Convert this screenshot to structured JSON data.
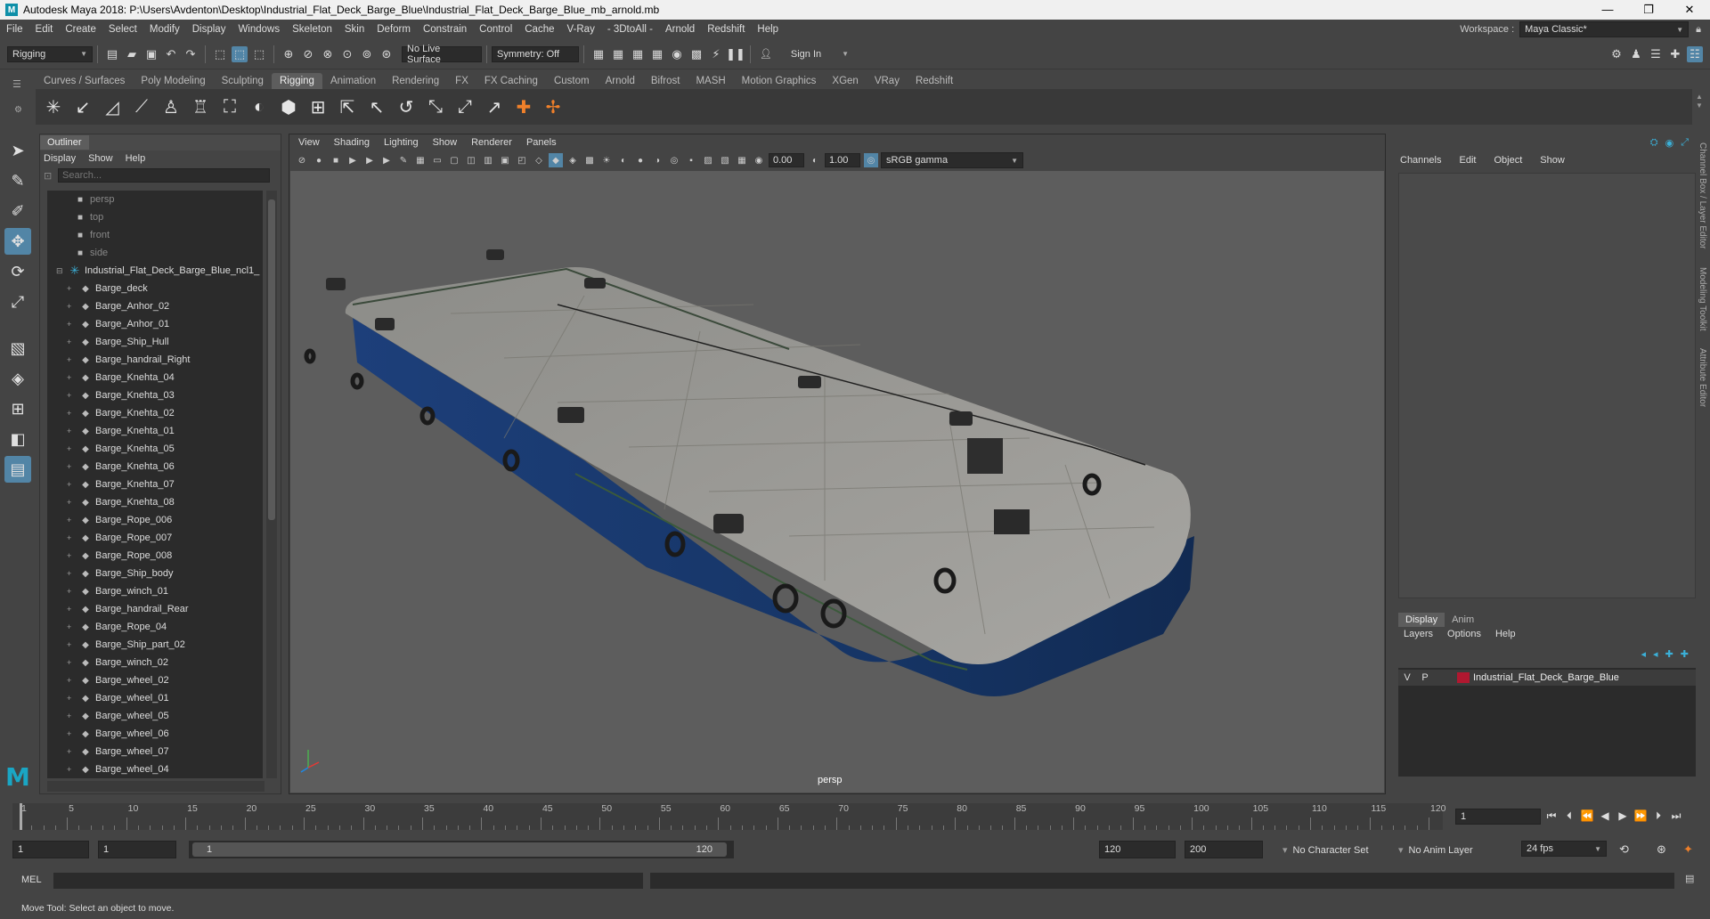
{
  "window": {
    "title": "Autodesk Maya 2018: P:\\Users\\Avdenton\\Desktop\\Industrial_Flat_Deck_Barge_Blue\\Industrial_Flat_Deck_Barge_Blue_mb_arnold.mb",
    "min": "—",
    "max": "❐",
    "close": "✕"
  },
  "menubar": {
    "items": [
      "File",
      "Edit",
      "Create",
      "Select",
      "Modify",
      "Display",
      "Windows",
      "Skeleton",
      "Skin",
      "Deform",
      "Constrain",
      "Control",
      "Cache",
      "V-Ray",
      "- 3DtoAll -",
      "Arnold",
      "Redshift",
      "Help"
    ],
    "workspace_label": "Workspace :",
    "workspace_value": "Maya Classic*"
  },
  "statusline": {
    "menuset": "Rigging",
    "live_surface": "No Live Surface",
    "symmetry": "Symmetry: Off",
    "sign_in": "Sign In"
  },
  "shelf": {
    "tabs": [
      "Curves / Surfaces",
      "Poly Modeling",
      "Sculpting",
      "Rigging",
      "Animation",
      "Rendering",
      "FX",
      "FX Caching",
      "Custom",
      "Arnold",
      "Bifrost",
      "MASH",
      "Motion Graphics",
      "XGen",
      "VRay",
      "Redshift"
    ],
    "active_tab": "Rigging"
  },
  "outliner": {
    "title": "Outliner",
    "menu": [
      "Display",
      "Show",
      "Help"
    ],
    "search_placeholder": "Search...",
    "cameras": [
      "persp",
      "top",
      "front",
      "side"
    ],
    "group": "Industrial_Flat_Deck_Barge_Blue_ncl1_",
    "children": [
      "Barge_deck",
      "Barge_Anhor_02",
      "Barge_Anhor_01",
      "Barge_Ship_Hull",
      "Barge_handrail_Right",
      "Barge_Knehta_04",
      "Barge_Knehta_03",
      "Barge_Knehta_02",
      "Barge_Knehta_01",
      "Barge_Knehta_05",
      "Barge_Knehta_06",
      "Barge_Knehta_07",
      "Barge_Knehta_08",
      "Barge_Rope_006",
      "Barge_Rope_007",
      "Barge_Rope_008",
      "Barge_Ship_body",
      "Barge_winch_01",
      "Barge_handrail_Rear",
      "Barge_Rope_04",
      "Barge_Ship_part_02",
      "Barge_winch_02",
      "Barge_wheel_02",
      "Barge_wheel_01",
      "Barge_wheel_05",
      "Barge_wheel_06",
      "Barge_wheel_07",
      "Barge_wheel_04"
    ]
  },
  "viewport": {
    "menu": [
      "View",
      "Shading",
      "Lighting",
      "Show",
      "Renderer",
      "Panels"
    ],
    "exposure": "0.00",
    "gamma": "1.00",
    "colorspace": "sRGB gamma",
    "camera_label": "persp"
  },
  "channelbox": {
    "menu": [
      "Channels",
      "Edit",
      "Object",
      "Show"
    ],
    "layer_tabs": [
      "Display",
      "Anim"
    ],
    "layer_menu": [
      "Layers",
      "Options",
      "Help"
    ],
    "layer_v": "V",
    "layer_p": "P",
    "layer_name": "Industrial_Flat_Deck_Barge_Blue",
    "layer_color": "#b01830"
  },
  "side_tabs": [
    "Channel Box / Layer Editor",
    "Modeling Toolkit",
    "Attribute Editor"
  ],
  "timeline": {
    "ticks": [
      "1",
      "5",
      "10",
      "15",
      "20",
      "25",
      "30",
      "35",
      "40",
      "45",
      "50",
      "55",
      "60",
      "65",
      "70",
      "75",
      "80",
      "85",
      "90",
      "95",
      "100",
      "105",
      "110",
      "115",
      "120"
    ],
    "current_frame": "1",
    "range_start": "1",
    "range_start_inner": "1",
    "slider_start": "1",
    "slider_end": "120",
    "range_end": "120",
    "anim_end": "200",
    "character_set": "No Character Set",
    "anim_layer": "No Anim Layer",
    "fps": "24 fps"
  },
  "commandline": {
    "label": "MEL"
  },
  "helpline": "Move Tool: Select an object to move."
}
